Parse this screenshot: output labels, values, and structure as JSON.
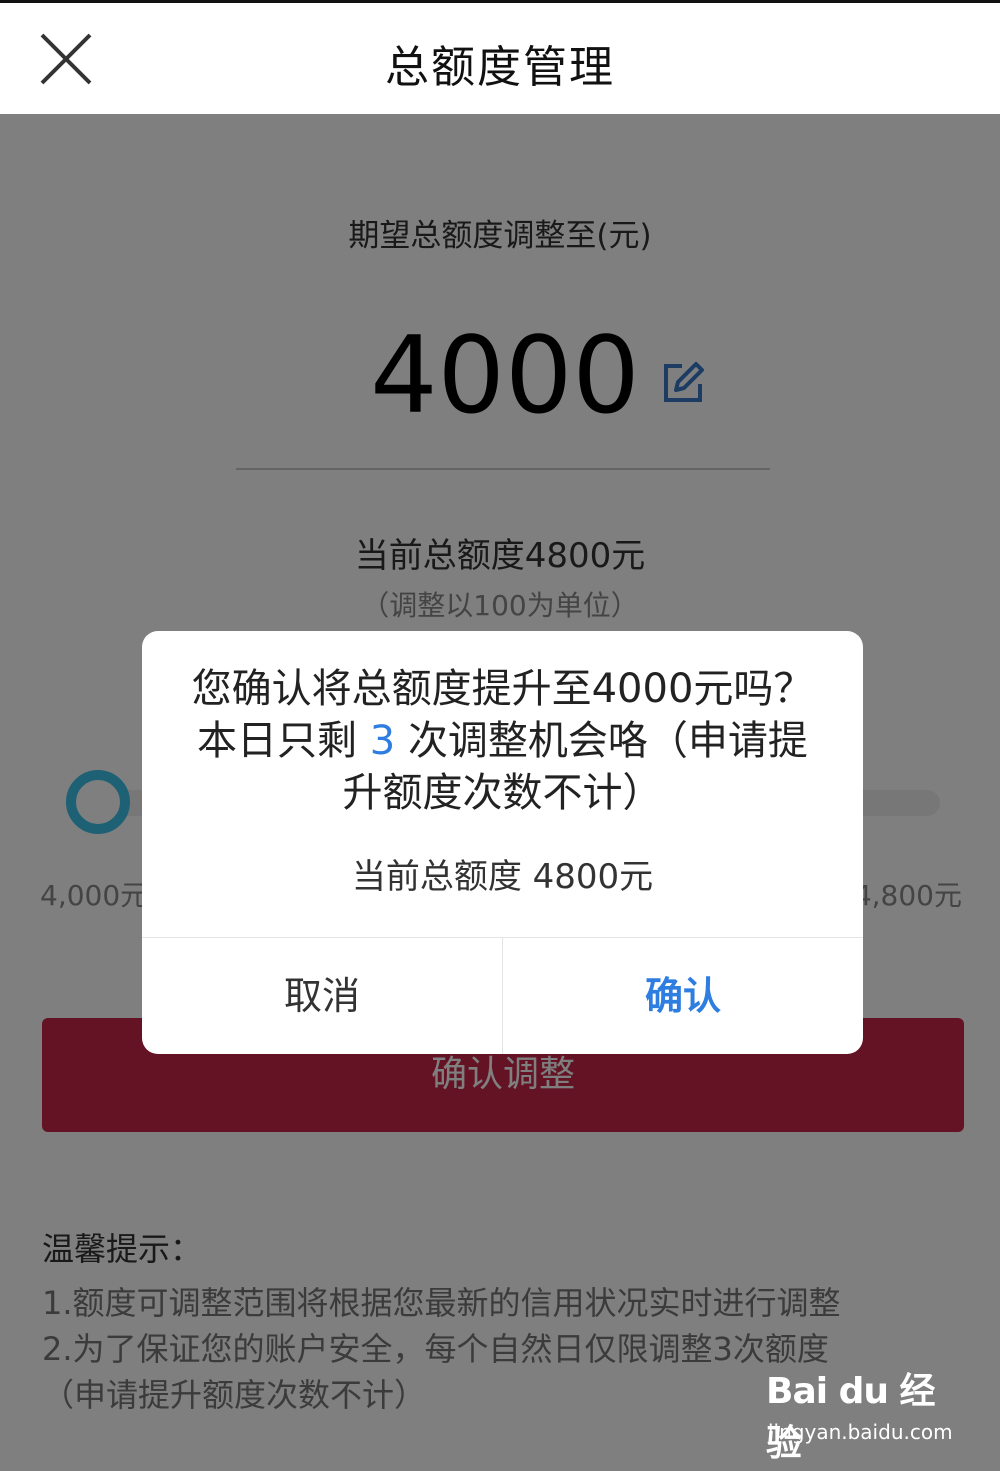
{
  "header": {
    "title": "总额度管理",
    "close_icon": "close-icon"
  },
  "main": {
    "target_label": "期望总额度调整至(元)",
    "target_amount": "4000",
    "edit_icon": "edit-icon",
    "current_total": "当前总额度4800元",
    "unit_hint": "（调整以100为单位）",
    "slider": {
      "min_label": "4,000元",
      "max_label": "4,800元",
      "value_fraction": 0.0
    },
    "confirm_adjust_label": "确认调整",
    "tips_title": "温馨提示：",
    "tips": [
      "1.额度可调整范围将根据您最新的信用状况实时进行调整",
      "2.为了保证您的账户安全，每个自然日仅限调整3次额度",
      "（申请提升额度次数不计）"
    ]
  },
  "dialog": {
    "message_part1": "您确认将总额度提升至4000元吗？本日只剩",
    "remaining_count": "3",
    "message_part2": "次调整机会咯（申请提升额度次数不计）",
    "sub_text": "当前总额度 4800元",
    "cancel_label": "取消",
    "confirm_label": "确认"
  },
  "watermark": {
    "logo": "Bai du 经验",
    "url": "jingyan.baidu.com"
  },
  "colors": {
    "accent_blue": "#2e7de0",
    "primary_button": "#c8264a",
    "slider_knob": "#3cc0e8"
  }
}
